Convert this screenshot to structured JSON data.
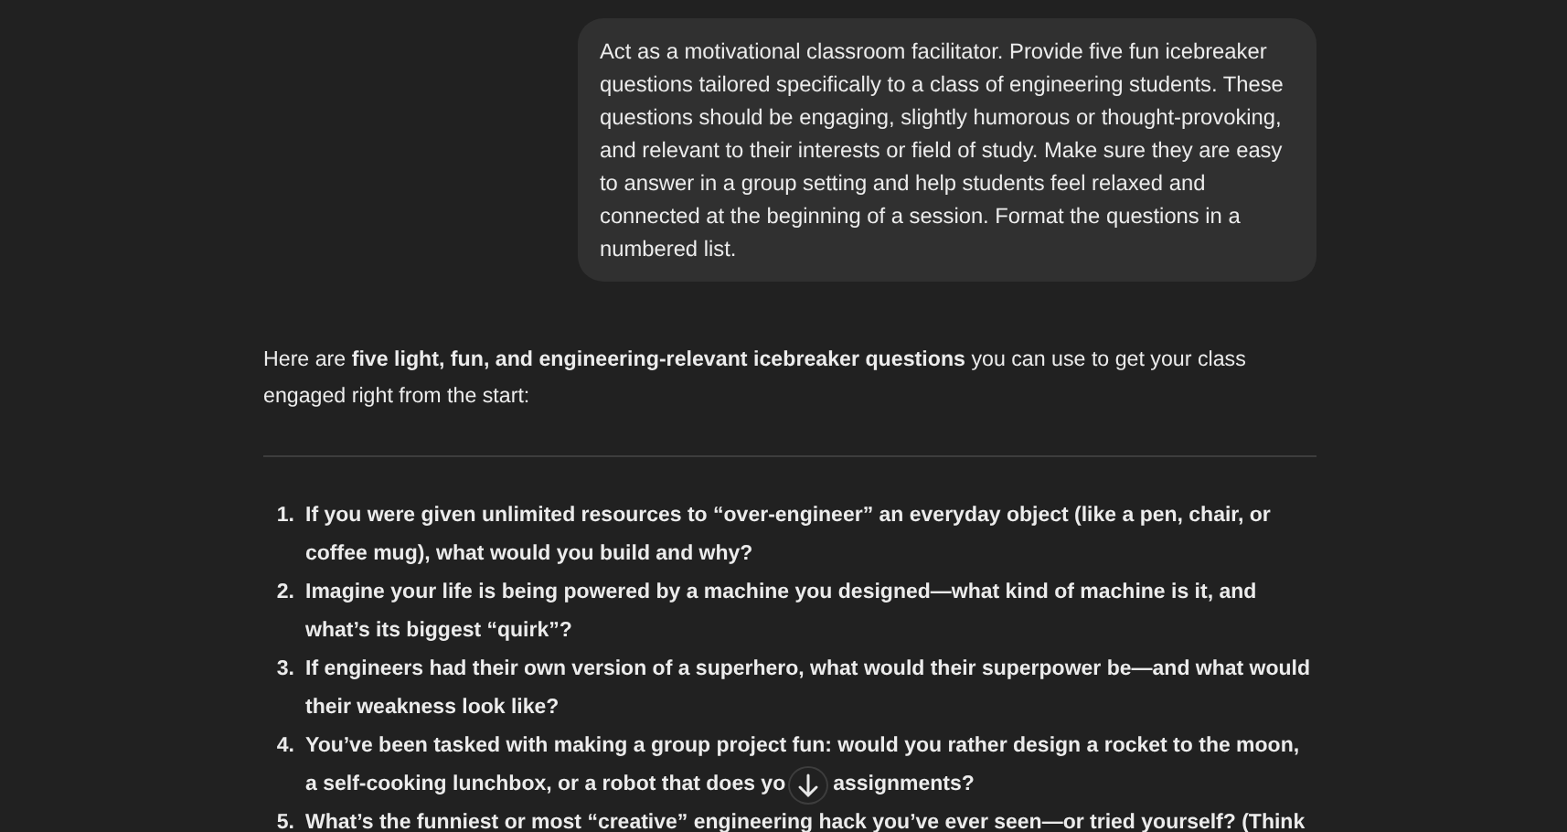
{
  "user_message": "Act as a motivational classroom facilitator. Provide five fun icebreaker questions tailored specifically to a class of engineering students. These questions should be engaging, slightly humorous or thought-provoking, and relevant to their interests or field of study. Make sure they are easy to answer in a group setting and help students feel relaxed and connected at the beginning of a session. Format the questions in a numbered list.",
  "reply_intro": "Here are **five light, fun, and engineering-relevant icebreaker questions** you can use to get your class engaged right from the start:",
  "questions": [
    {
      "number": "1.",
      "lines": [
        [
          "If you were given unlimited resources to “over-engineer” an everyday object (like a pen, chair, or"
        ],
        [
          "coffee mug), what would you build and why?"
        ]
      ]
    },
    {
      "number": "2.",
      "lines": [
        [
          "Imagine your life is being powered by a machine you designed—what kind of machine is it, and"
        ],
        [
          "what’s its biggest “quirk”?"
        ]
      ]
    },
    {
      "number": "3.",
      "lines": [
        [
          "If engineers had their own version of a superhero, what would their superpower be—and what would"
        ],
        [
          "their weakness look like?"
        ]
      ]
    },
    {
      "number": "4.",
      "lines": [
        [
          "You’ve been tasked with making a group project fun: would you rather design a rocket to the moon,"
        ],
        [
          "a self-cooking lunchbox, or a robot that does yo",
          "assignments?"
        ]
      ]
    },
    {
      "number": "5.",
      "lines": [
        [
          "What’s the funniest or most “creative” engineering hack you’ve ever seen—or tried yourself? (Think"
        ]
      ]
    }
  ]
}
